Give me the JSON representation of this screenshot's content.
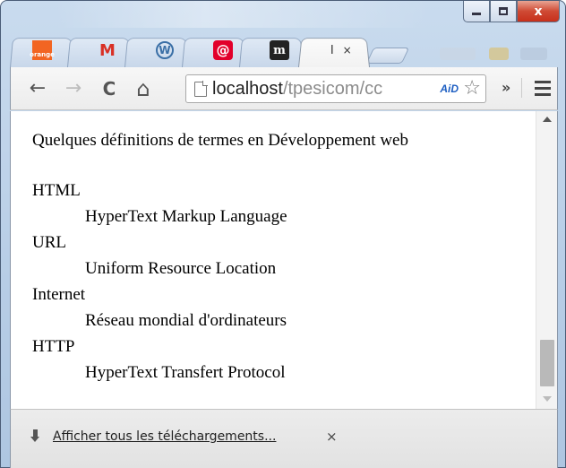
{
  "browser": {
    "tabs": [
      {
        "favicon": "orange-icon",
        "favicon_text": "orange"
      },
      {
        "favicon": "gmail-icon",
        "favicon_text": "M"
      },
      {
        "favicon": "wordpress-icon",
        "favicon_text": "W"
      },
      {
        "favicon": "at-icon",
        "favicon_text": "@"
      },
      {
        "favicon": "m-icon",
        "favicon_text": "m"
      }
    ],
    "active_tab": {
      "label": "l",
      "close": "×"
    },
    "toolbar": {
      "back": "←",
      "forward": "→",
      "reload": "C",
      "home": "⌂",
      "url_host": "localhost",
      "url_path": "/tpesicom/cc",
      "extension_text": "AiD",
      "star": "☆",
      "more": "»"
    },
    "window_controls": {
      "close": "x"
    }
  },
  "page": {
    "intro": "Quelques définitions de termes en Développement web",
    "definitions": [
      {
        "term": "HTML",
        "definition": "HyperText Markup Language"
      },
      {
        "term": "URL",
        "definition": "Uniform Resource Location"
      },
      {
        "term": "Internet",
        "definition": "Réseau mondial d'ordinateurs"
      },
      {
        "term": "HTTP",
        "definition": "HyperText Transfert Protocol"
      }
    ]
  },
  "download_shelf": {
    "link": "Afficher tous les téléchargements...",
    "close": "×"
  },
  "colors": {
    "frame": "#b7cde6",
    "close_button": "#c7301b",
    "abp_green": "#2a8a2a",
    "abp_blue": "#1e5fc2"
  }
}
